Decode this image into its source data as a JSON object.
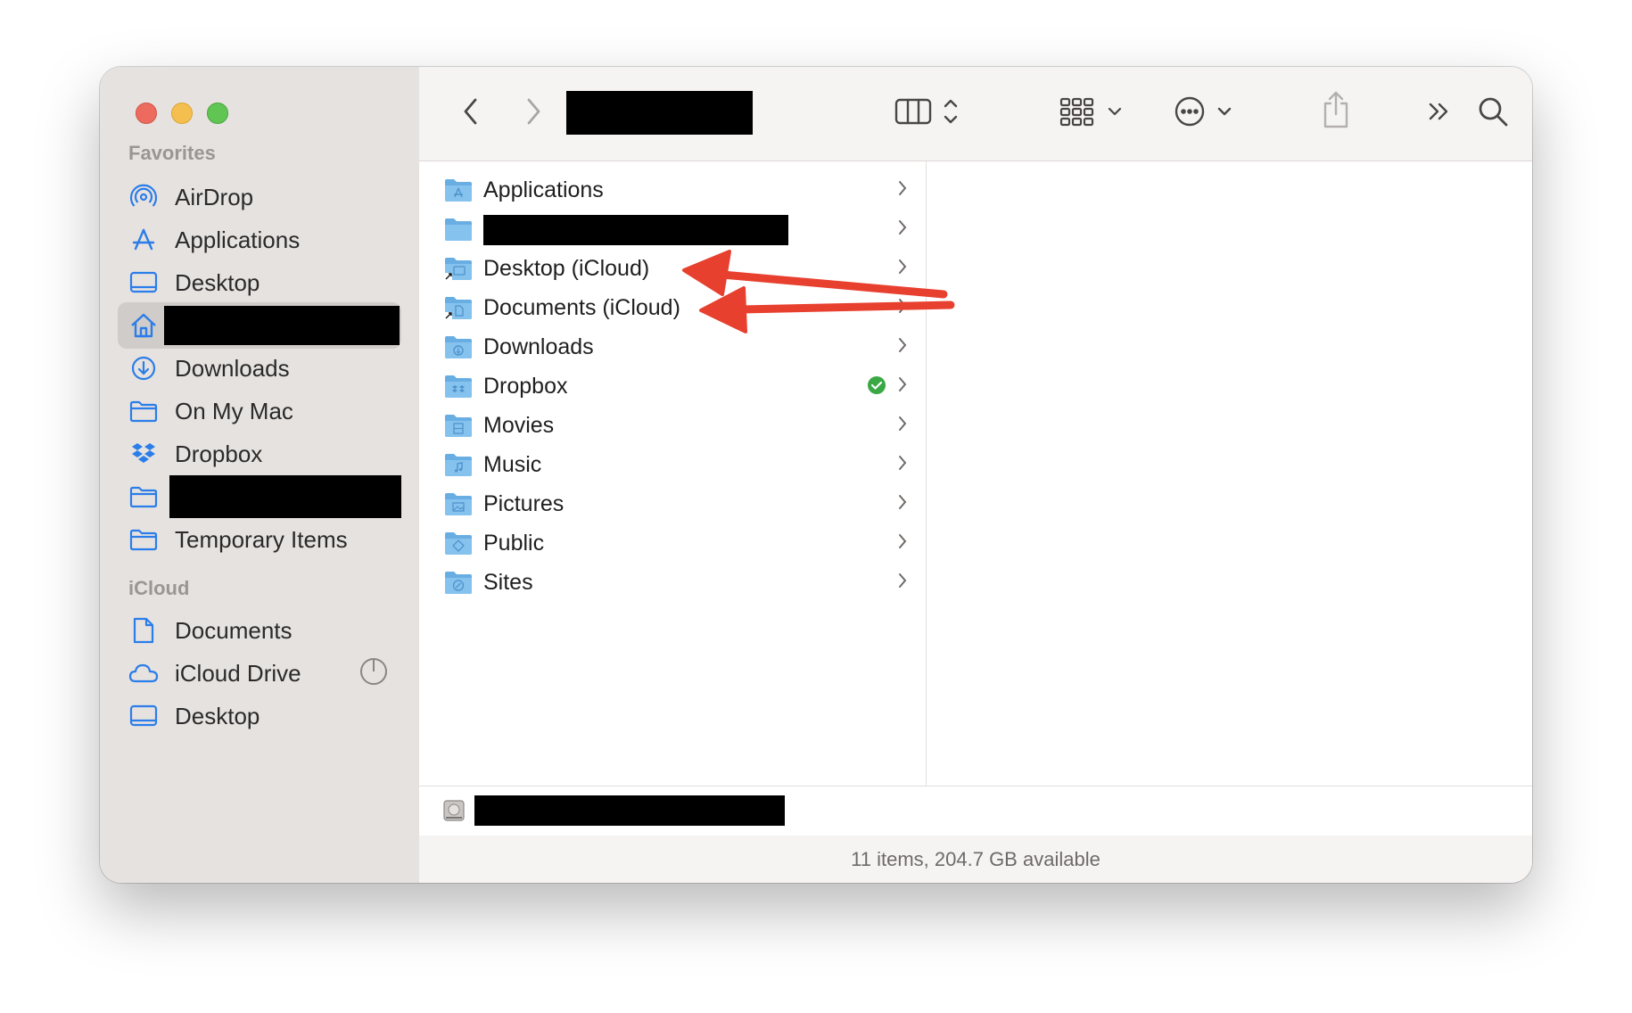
{
  "sidebar": {
    "favorites_title": "Favorites",
    "icloud_title": "iCloud",
    "favorites": [
      {
        "label": "AirDrop",
        "icon": "airdrop-icon"
      },
      {
        "label": "Applications",
        "icon": "applications-icon"
      },
      {
        "label": "Desktop",
        "icon": "desktop-icon"
      },
      {
        "label": "",
        "icon": "home-icon",
        "redacted": true,
        "selected": true
      },
      {
        "label": "Downloads",
        "icon": "downloads-icon"
      },
      {
        "label": "On My Mac",
        "icon": "folder-icon"
      },
      {
        "label": "Dropbox",
        "icon": "dropbox-icon"
      },
      {
        "label": "",
        "icon": "folder-icon",
        "redacted": true
      },
      {
        "label": "Temporary Items",
        "icon": "folder-icon"
      }
    ],
    "icloud": [
      {
        "label": "Documents",
        "icon": "document-icon"
      },
      {
        "label": "iCloud Drive",
        "icon": "cloud-icon"
      },
      {
        "label": "Desktop",
        "icon": "desktop-icon"
      }
    ]
  },
  "toolbar": {
    "title_redacted": true,
    "icons": [
      "back-icon",
      "forward-icon",
      "column-view-icon",
      "group-icon",
      "action-icon",
      "share-icon",
      "more-icon",
      "search-icon"
    ]
  },
  "files": [
    {
      "label": "Applications",
      "icon": "applications-folder-icon"
    },
    {
      "label": "",
      "icon": "folder-icon",
      "redacted": true
    },
    {
      "label": "Desktop (iCloud)",
      "icon": "desktop-alias-folder-icon"
    },
    {
      "label": "Documents (iCloud)",
      "icon": "documents-alias-folder-icon"
    },
    {
      "label": "Downloads",
      "icon": "downloads-folder-icon"
    },
    {
      "label": "Dropbox",
      "icon": "dropbox-folder-icon",
      "synced": true
    },
    {
      "label": "Movies",
      "icon": "movies-folder-icon"
    },
    {
      "label": "Music",
      "icon": "music-folder-icon"
    },
    {
      "label": "Pictures",
      "icon": "pictures-folder-icon"
    },
    {
      "label": "Public",
      "icon": "public-folder-icon"
    },
    {
      "label": "Sites",
      "icon": "sites-folder-icon"
    }
  ],
  "status": {
    "text": "11 items, 204.7 GB available"
  },
  "colors": {
    "accent": "#2b7de9",
    "folder": "#7cb9e8",
    "annotation_arrow": "#e8402f",
    "sync_ok": "#3aa845"
  }
}
